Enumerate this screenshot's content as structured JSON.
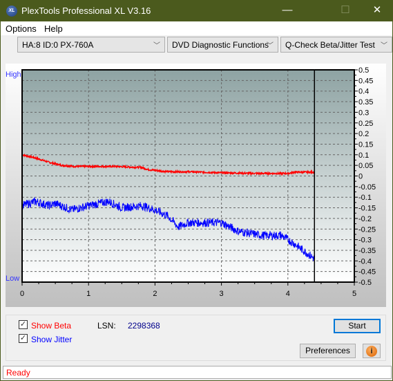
{
  "window": {
    "title": "PlexTools Professional XL V3.16",
    "logo_text": "XL",
    "minimize": "—",
    "maximize": "☐",
    "close": "✕"
  },
  "menu": {
    "options": "Options",
    "help": "Help"
  },
  "toolbar": {
    "drive": "HA:8 ID:0  PX-760A",
    "function": "DVD Diagnostic Functions",
    "test": "Q-Check Beta/Jitter Test"
  },
  "controls": {
    "show_beta": "Show Beta",
    "show_beta_checked": true,
    "show_jitter": "Show Jitter",
    "show_jitter_checked": true,
    "lsn_label": "LSN:",
    "lsn_value": "2298368",
    "start": "Start",
    "preferences": "Preferences",
    "info_icon": "info-icon"
  },
  "status": "Ready",
  "colors": {
    "beta": "#ff0000",
    "jitter": "#0000ff",
    "titlebar": "#4b5a1d"
  },
  "chart_data": {
    "type": "line",
    "left_labels": {
      "high": "High",
      "low": "Low"
    },
    "xlim": [
      0,
      5
    ],
    "ylim": [
      -0.5,
      0.5
    ],
    "x_ticks": [
      "0",
      "1",
      "2",
      "3",
      "4",
      "5"
    ],
    "y_ticks": [
      "0.5",
      "0.45",
      "0.4",
      "0.35",
      "0.3",
      "0.25",
      "0.2",
      "0.15",
      "0.1",
      "0.05",
      "0",
      "-0.05",
      "-0.1",
      "-0.15",
      "-0.2",
      "-0.25",
      "-0.3",
      "-0.35",
      "-0.4",
      "-0.45",
      "-0.5"
    ],
    "grid": true,
    "marker_x": 4.4,
    "series": [
      {
        "name": "Beta",
        "color": "#ff0000",
        "x": [
          0,
          0.2,
          0.4,
          0.6,
          0.8,
          1.0,
          1.4,
          1.8,
          1.9,
          2.2,
          2.5,
          3.0,
          3.5,
          4.0,
          4.1,
          4.4
        ],
        "y": [
          0.1,
          0.085,
          0.065,
          0.05,
          0.045,
          0.045,
          0.045,
          0.04,
          0.03,
          0.02,
          0.02,
          0.015,
          0.012,
          0.012,
          0.018,
          0.018
        ]
      },
      {
        "name": "Jitter",
        "color": "#0000ff",
        "x": [
          0,
          0.2,
          0.4,
          0.5,
          0.75,
          1.0,
          1.3,
          1.5,
          1.8,
          2.0,
          2.2,
          2.35,
          2.5,
          3.0,
          3.25,
          3.6,
          3.9,
          4.1,
          4.4
        ],
        "y": [
          -0.14,
          -0.12,
          -0.14,
          -0.13,
          -0.16,
          -0.14,
          -0.12,
          -0.15,
          -0.14,
          -0.16,
          -0.19,
          -0.24,
          -0.22,
          -0.22,
          -0.26,
          -0.28,
          -0.28,
          -0.32,
          -0.39
        ]
      }
    ]
  }
}
